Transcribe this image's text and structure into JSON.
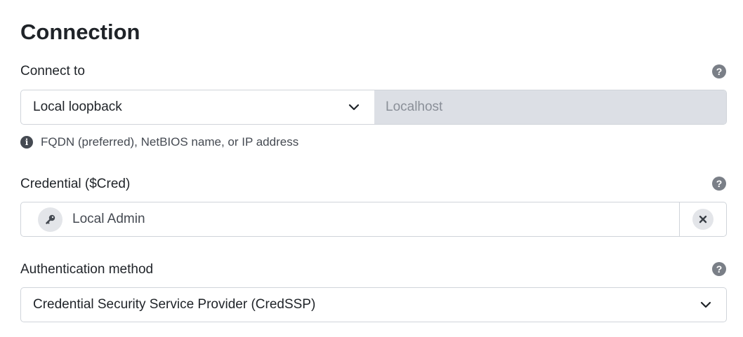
{
  "section": {
    "title": "Connection"
  },
  "connect_to": {
    "label": "Connect to",
    "help_icon": "question-icon",
    "selected_option": "Local loopback",
    "host_placeholder": "Localhost",
    "hint_icon": "info-icon",
    "hint": "FQDN (preferred), NetBIOS name, or IP address"
  },
  "credential": {
    "label": "Credential ($Cred)",
    "help_icon": "question-icon",
    "value_icon": "key-icon",
    "value": "Local Admin",
    "clear_icon": "close-icon"
  },
  "authentication": {
    "label": "Authentication method",
    "help_icon": "question-icon",
    "selected_option": "Credential Security Service Provider (CredSSP)"
  },
  "colors": {
    "disabled_field_bg": "#dcdfe5",
    "border": "#d0d4da",
    "icon_grey": "#7a7f87",
    "text_dark": "#1f2328"
  }
}
